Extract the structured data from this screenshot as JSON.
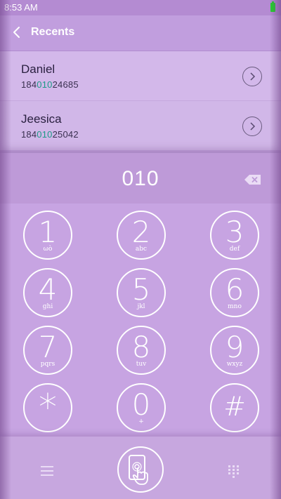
{
  "status_bar": {
    "time": "8:53 AM"
  },
  "header": {
    "title": "Recents"
  },
  "recents": [
    {
      "name": "Daniel",
      "number_prefix": "184",
      "number_match": "010",
      "number_suffix": "24685"
    },
    {
      "name": "Jeesica",
      "number_prefix": "184",
      "number_match": "010",
      "number_suffix": "25042"
    }
  ],
  "dialer": {
    "input_value": "010",
    "keys": [
      {
        "digit": "1",
        "letters": "ωò"
      },
      {
        "digit": "2",
        "letters": "abc"
      },
      {
        "digit": "3",
        "letters": "def"
      },
      {
        "digit": "4",
        "letters": "ghi"
      },
      {
        "digit": "5",
        "letters": "jkl"
      },
      {
        "digit": "6",
        "letters": "mno"
      },
      {
        "digit": "7",
        "letters": "pqrs"
      },
      {
        "digit": "8",
        "letters": "tuv"
      },
      {
        "digit": "9",
        "letters": "wxyz"
      },
      {
        "digit": "*",
        "letters": ""
      },
      {
        "digit": "0",
        "letters": "+"
      },
      {
        "digit": "#",
        "letters": ""
      }
    ]
  },
  "icons": {
    "back": "chevron-left-icon",
    "backspace": "backspace-icon",
    "menu": "menu-icon",
    "call": "phone-touch-icon",
    "keypad": "keypad-grid-icon"
  },
  "colors": {
    "background": "#c3a1dd",
    "highlight_digits": "#1d9a86",
    "battery": "#22d12a"
  }
}
